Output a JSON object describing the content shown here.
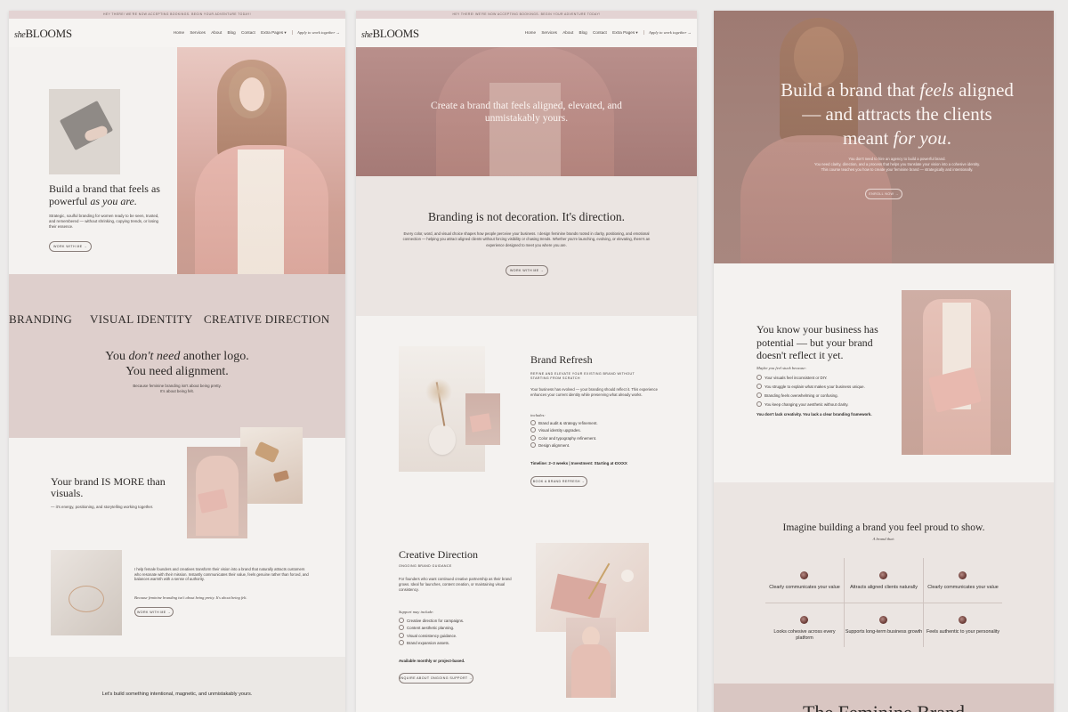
{
  "topbar": {
    "text": "Hey there! We're now accepting bookings. Begin your adventure today!"
  },
  "logo": {
    "script": "she",
    "word": "BLOOMS"
  },
  "nav": {
    "links": [
      "Home",
      "Services",
      "About",
      "Blog",
      "Contact",
      "Extra Pages ▾"
    ],
    "cta": "Apply to work together →"
  },
  "page1": {
    "hero_heading_a": "Build a brand that feels as",
    "hero_heading_b": "powerful ",
    "hero_heading_em": "as you are.",
    "hero_body": "Strategic, soulful branding for women ready to be seen, trusted, and remembered — without shrinking, copying trends, or losing their essence.",
    "hero_button": "Work with me →",
    "marquee": [
      "BRANDING",
      "VISUAL IDENTITY",
      "CREATIVE DIRECTION"
    ],
    "align_a": "You ",
    "align_em": "don't need",
    "align_b": " another logo.",
    "align_c": "You need alignment.",
    "align_sub_a": "Because feminine branding isn't about being pretty.",
    "align_sub_b": "It's about being felt.",
    "more_heading": "Your brand IS MORE than visuals.",
    "more_sub": "— it's energy, positioning, and storytelling working together.",
    "help_body": "I help female founders and creatives transform their vision into a brand that naturally attracts customers who resonate with their mission. Instantly communicates their value, feels genuine rather than forced, and balances warmth with a sense of authority.",
    "help_quote": "Because feminine branding isn't about being pretty. It's about being felt.",
    "help_button": "Work with me →",
    "footer_line": "Let's build something intentional, magnetic, and unmistakably yours."
  },
  "page2": {
    "hero_line1": "Create a brand that feels aligned, elevated, and",
    "hero_line2": "unmistakably yours.",
    "direction_heading": "Branding is not decoration. It's direction.",
    "direction_body": "Every color, word, and visual choice shapes how people perceive your business. I design feminine brands rooted in clarity, positioning, and emotional connection — helping you attract aligned clients without forcing visibility or chasing trends. Whether you're launching, evolving, or elevating, there's an experience designed to meet you where you are.",
    "direction_button": "Work with me →",
    "refresh_title": "Brand Refresh",
    "refresh_kicker": "Refine and elevate your existing brand without starting from scratch",
    "refresh_body": "Your business has evolved — your branding should reflect it. This experience enhances your current identity while preserving what already works.",
    "includes_label": "includes:",
    "refresh_items": [
      "Brand audit & strategy refinement.",
      "Visual identity upgrades.",
      "Color and typography refinement.",
      "Design alignment."
    ],
    "refresh_timeline": "Timeline: 2–3 weeks | Investment: Starting at €XXXX",
    "refresh_button": "Book a brand refresh →",
    "cd_title": "Creative Direction",
    "cd_kicker": "Ongoing brand guidance",
    "cd_body": "For founders who want continued creative partnership as their brand grows. Ideal for launches, content creation, or maintaining visual consistency.",
    "cd_support_label": "Support may include:",
    "cd_items": [
      "Creative direction for campaigns.",
      "Content aesthetic planning.",
      "Visual consistency guidance.",
      "Brand expansion assets."
    ],
    "cd_availability": "Available monthly or project-based.",
    "cd_button": "Inquire about ongoing support →"
  },
  "page3": {
    "hero_a": "Build a brand that ",
    "hero_em1": "feels",
    "hero_b": " aligned",
    "hero_c": "— and attracts the clients",
    "hero_d": "meant ",
    "hero_em2": "for you",
    "hero_e": ".",
    "hero_sub1": "You don't need to hire an agency to build a powerful brand.",
    "hero_sub2": "You need clarity, direction, and a process that helps you translate your vision into a cohesive identity.",
    "hero_sub3": "This course teaches you how to create your feminine brand — strategically and intentionally.",
    "hero_button": "Enroll now →",
    "potential_heading": "You know your business has potential — but your brand doesn't reflect it yet.",
    "stuck_label": "Maybe you feel stuck because:",
    "stuck_items": [
      "Your visuals feel inconsistent or DIY.",
      "You struggle to explain what makes your business unique.",
      "Branding feels overwhelming or confusing.",
      "You keep changing your aesthetic without clarity."
    ],
    "stuck_close": "You don't lack creativity. You lack a clear branding framework.",
    "imagine_heading": "Imagine building a brand you feel proud to show.",
    "imagine_sub": "A brand that:",
    "benefits": [
      "Clearly communicates your value",
      "Attracts aligned clients naturally",
      "Clearly communicates your value",
      "Looks cohesive across every platform",
      "Supports long-term business growth",
      "Feels authentic to your personality"
    ],
    "bottom_heading": "The Feminine Brand"
  }
}
